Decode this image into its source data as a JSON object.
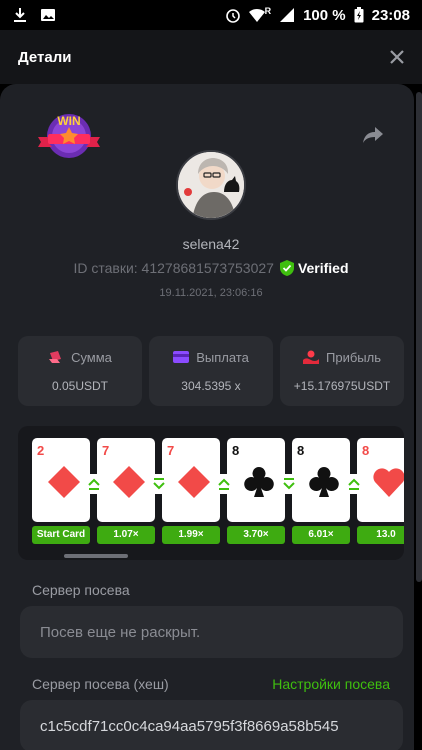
{
  "status_bar": {
    "battery": "100 %",
    "time": "23:08",
    "signal_label": "R"
  },
  "header": {
    "title": "Детали"
  },
  "profile": {
    "username": "selena42",
    "bet_id": "ID ставки: 41278681573753027",
    "verified_label": "Verified",
    "timestamp": "19.11.2021, 23:06:16",
    "win_badge_text": "WIN"
  },
  "stats": [
    {
      "label": "Сумма",
      "value": "0.05USDT",
      "icon": "bet-amount-icon"
    },
    {
      "label": "Выплата",
      "value": "304.5395 x",
      "icon": "payout-icon"
    },
    {
      "label": "Прибыль",
      "value": "+15.176975USDT",
      "icon": "profit-icon"
    }
  ],
  "cards": [
    {
      "rank": "2",
      "suit": "diamond",
      "multiplier": "Start Card"
    },
    {
      "rank": "7",
      "suit": "diamond",
      "multiplier": "1.07×"
    },
    {
      "rank": "7",
      "suit": "diamond",
      "multiplier": "1.99×"
    },
    {
      "rank": "8",
      "suit": "club",
      "multiplier": "3.70×"
    },
    {
      "rank": "8",
      "suit": "club",
      "multiplier": "6.01×"
    },
    {
      "rank": "8",
      "suit": "heart",
      "multiplier": "13.0"
    }
  ],
  "arrows": [
    "up",
    "down",
    "up",
    "down",
    "up"
  ],
  "seed": {
    "server_seed_label": "Сервер посева",
    "server_seed_value": "Посев еще не раскрыт.",
    "hash_label": "Сервер посева (хеш)",
    "settings_link": "Настройки посева",
    "hash_value": "c1c5cdf71cc0c4ca94aa5795f3f8669a58b545"
  },
  "colors": {
    "accent_green": "#3fbf0f",
    "panel": "#1f2126",
    "card_red": "#f24a48"
  }
}
